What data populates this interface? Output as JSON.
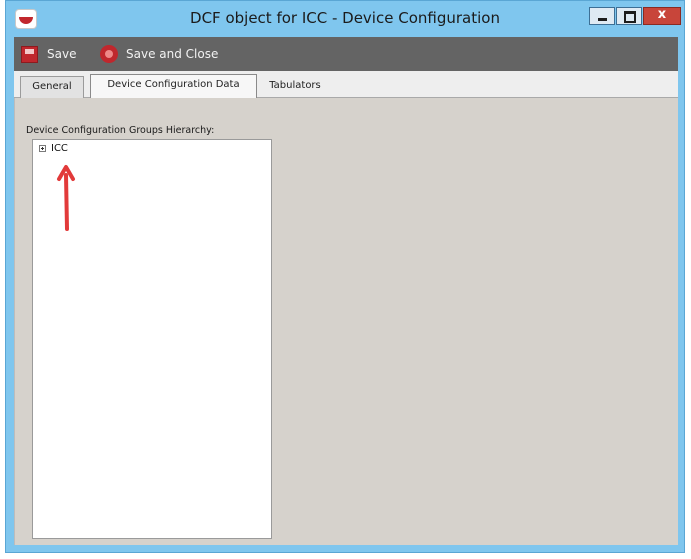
{
  "window": {
    "title": "DCF object for ICC - Device Configuration",
    "controls": {
      "minimize_icon": "minimize-icon",
      "maximize_icon": "maximize-icon",
      "close_label": "x"
    }
  },
  "toolbar": {
    "save_label": "Save",
    "save_close_label": "Save and Close"
  },
  "tabs": [
    {
      "label": "General",
      "active": false
    },
    {
      "label": "Device Configuration Data",
      "active": true
    },
    {
      "label": "Tabulators",
      "active": false
    }
  ],
  "content": {
    "groups_label": "Device Configuration Groups Hierarchy:",
    "tree": [
      {
        "label": "ICC",
        "expanded": false
      }
    ]
  },
  "colors": {
    "titlebar": "#7fc6ee",
    "toolbar": "#646464",
    "accent_red": "#c0272d",
    "panel_bg": "#d6d2cc",
    "annotation_arrow": "#e23a3a"
  }
}
